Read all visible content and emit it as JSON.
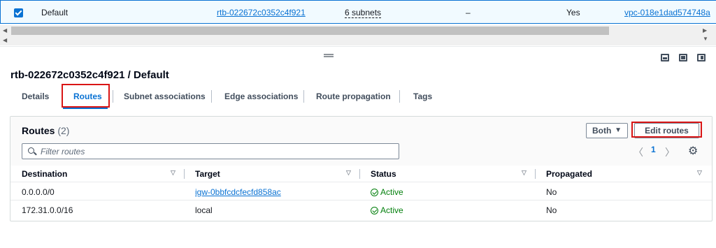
{
  "top_row": {
    "name": "Default",
    "route_table_id": "rtb-022672c0352c4f921",
    "subnets": "6 subnets",
    "edge": "–",
    "main": "Yes",
    "vpc": "vpc-018e1dad574748a"
  },
  "detail": {
    "title": "rtb-022672c0352c4f921 / Default"
  },
  "tabs": [
    {
      "label": "Details"
    },
    {
      "label": "Routes"
    },
    {
      "label": "Subnet associations"
    },
    {
      "label": "Edge associations"
    },
    {
      "label": "Route propagation"
    },
    {
      "label": "Tags"
    }
  ],
  "active_tab": "Routes",
  "routes": {
    "title": "Routes",
    "count": "(2)",
    "filter_selector": "Both",
    "edit_button": "Edit routes",
    "filter_placeholder": "Filter routes",
    "page": "1",
    "columns": [
      "Destination",
      "Target",
      "Status",
      "Propagated"
    ],
    "rows": [
      {
        "destination": "0.0.0.0/0",
        "target": "igw-0bbfcdcfecfd858ac",
        "target_is_link": true,
        "status": "Active",
        "propagated": "No"
      },
      {
        "destination": "172.31.0.0/16",
        "target": "local",
        "target_is_link": false,
        "status": "Active",
        "propagated": "No"
      }
    ]
  },
  "colors": {
    "accent": "#0972d3",
    "highlight": "#d91515",
    "success": "#037f0c"
  },
  "icons": [
    "checkbox-checked-icon",
    "scroll-left-icon",
    "scroll-right-icon",
    "drag-handle-icon",
    "panel-bottom-icon",
    "panel-side-icon",
    "panel-right-icon",
    "search-icon",
    "chevron-left-icon",
    "chevron-right-icon",
    "gear-icon",
    "sort-icon",
    "status-ok-icon",
    "caret-down-icon"
  ]
}
